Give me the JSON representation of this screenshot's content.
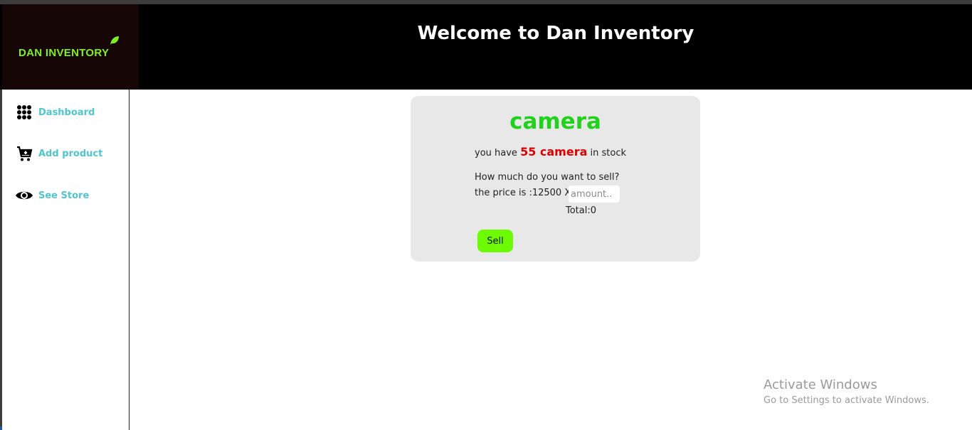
{
  "app": {
    "logo_text": "DAN INVENTORY",
    "header_title": "Welcome to Dan Inventory"
  },
  "sidebar": {
    "items": [
      {
        "label": "Dashboard",
        "icon": "grid-dots-icon"
      },
      {
        "label": "Add product",
        "icon": "cart-add-icon"
      },
      {
        "label": "See Store",
        "icon": "eye-icon"
      }
    ]
  },
  "product": {
    "name": "camera",
    "stock_prefix": "you have ",
    "stock_qty": "55 camera",
    "stock_suffix": " in stock",
    "question": "How much do you want to sell?",
    "price_text": "the price is :12500 X",
    "amount_placeholder": "amount..",
    "amount_value": "",
    "total_text": "Total:0",
    "sell_label": "Sell"
  },
  "watermark": {
    "title": "Activate Windows",
    "subtitle": "Go to Settings to activate Windows."
  },
  "colors": {
    "accent_green": "#7ff21c",
    "product_green": "#22d11c",
    "stock_red": "#e00000",
    "sell_button": "#6dfb03",
    "nav_text": "#4fc5cf"
  }
}
